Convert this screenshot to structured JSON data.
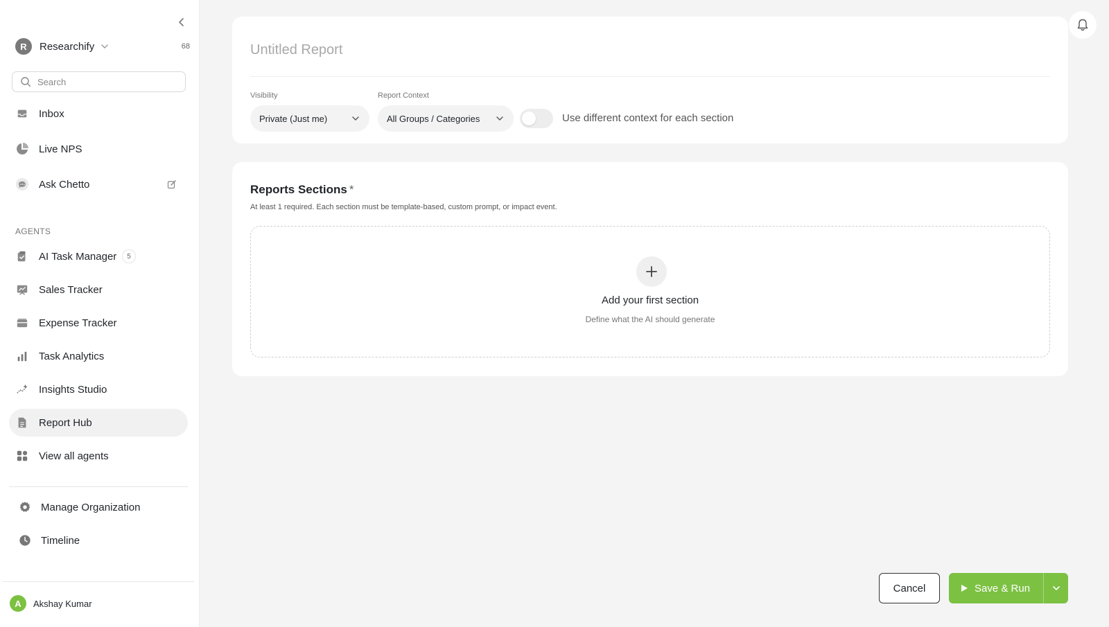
{
  "sidebar": {
    "org": {
      "avatar_letter": "R",
      "name": "Researchify",
      "count": "68"
    },
    "search": {
      "placeholder": "Search"
    },
    "items": [
      {
        "label": "Inbox",
        "icon": "inbox-icon"
      },
      {
        "label": "Live NPS",
        "icon": "pie-chart-icon"
      },
      {
        "label": "Ask Chetto",
        "icon": "chat-bubble-icon"
      }
    ],
    "agents_label": "AGENTS",
    "agents": [
      {
        "label": "AI Task Manager",
        "icon": "clipboard-check-icon",
        "badge": "5"
      },
      {
        "label": "Sales Tracker",
        "icon": "trend-board-icon"
      },
      {
        "label": "Expense Tracker",
        "icon": "wallet-icon"
      },
      {
        "label": "Task Analytics",
        "icon": "bar-chart-icon"
      },
      {
        "label": "Insights Studio",
        "icon": "sparkle-trend-icon"
      },
      {
        "label": "Report Hub",
        "icon": "document-icon",
        "active": true
      },
      {
        "label": "View all agents",
        "icon": "grid-icon"
      }
    ],
    "bottom": [
      {
        "label": "Manage Organization",
        "icon": "gear-icon"
      },
      {
        "label": "Timeline",
        "icon": "clock-icon"
      }
    ],
    "user": {
      "avatar_letter": "A",
      "name": "Akshay Kumar"
    }
  },
  "report": {
    "title_placeholder": "Untitled Report",
    "title_value": "",
    "visibility_label": "Visibility",
    "visibility_value": "Private (Just me)",
    "context_label": "Report Context",
    "context_value": "All Groups / Categories",
    "toggle_label": "Use different context for each section",
    "toggle_on": false
  },
  "sections": {
    "title": "Reports Sections",
    "required_mark": "*",
    "help": "At least 1 required. Each section must be template-based, custom prompt, or impact event.",
    "empty_title": "Add your first section",
    "empty_sub": "Define what the AI should generate"
  },
  "footer": {
    "cancel_label": "Cancel",
    "save_label": "Save & Run"
  },
  "colors": {
    "accent": "#7cc142",
    "page_bg": "#f4f4f5",
    "active_nav": "#f1f1f2"
  }
}
